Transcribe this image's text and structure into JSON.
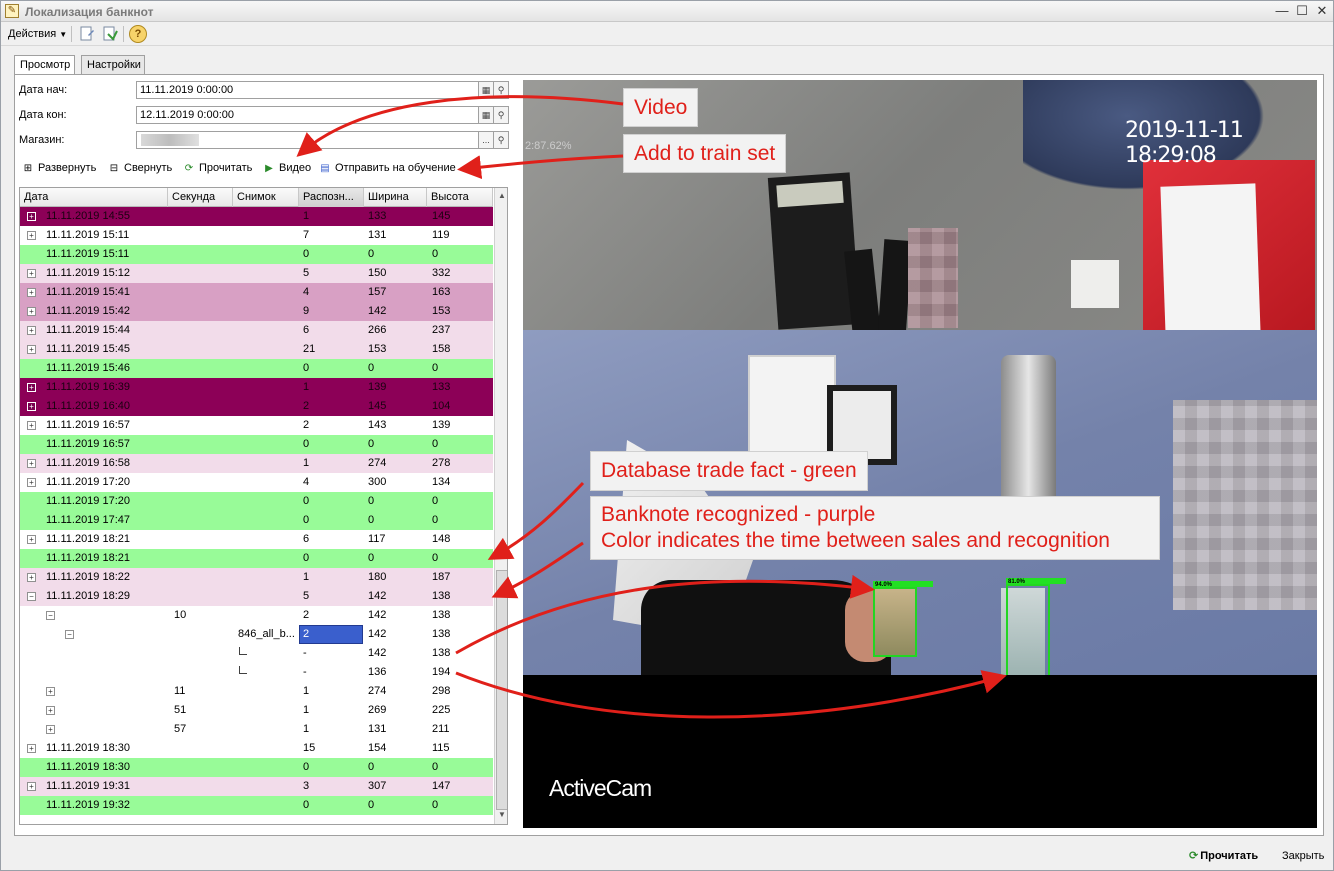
{
  "window": {
    "title": "Локализация банкнот",
    "icon": "document-edit-icon",
    "controls": [
      "minimize-icon",
      "maximize-icon",
      "close-icon"
    ]
  },
  "toolbar": {
    "actions_label": "Действия",
    "help_label": "?"
  },
  "tabs": [
    {
      "label": "Просмотр",
      "active": true
    },
    {
      "label": "Настройки",
      "active": false
    }
  ],
  "form": {
    "date_start_label": "Дата нач:",
    "date_start_value": "11.11.2019  0:00:00",
    "date_end_label": "Дата кон:",
    "date_end_value": "12.11.2019  0:00:00",
    "store_label": "Магазин:",
    "store_value": "",
    "calendar_icon": "calendar-icon",
    "search_icon": "search-icon",
    "more_label": "..."
  },
  "commands": {
    "expand": "Развернуть",
    "collapse": "Свернуть",
    "read": "Прочитать",
    "video": "Видео",
    "send_train": "Отправить на обучение"
  },
  "grid": {
    "columns": [
      "Дата",
      "Секунда",
      "Снимок",
      "Распозн...",
      "Ширина",
      "Высота"
    ],
    "colors": {
      "dark_purple": "#8c0057",
      "medium_purple": "#d8a0c4",
      "light_purple": "#f2dcea",
      "green": "#98fb98",
      "white": "#ffffff",
      "selection": "#3a5fcd"
    },
    "rows": [
      {
        "date": "11.11.2019 14:55",
        "sec": "",
        "snap": "",
        "rec": "1",
        "w": "133",
        "h": "145",
        "color": "dark",
        "level": 0,
        "expander": "+"
      },
      {
        "date": "11.11.2019 15:11",
        "sec": "",
        "snap": "",
        "rec": "7",
        "w": "131",
        "h": "119",
        "color": "white",
        "level": 0,
        "expander": "+"
      },
      {
        "date": "11.11.2019 15:11",
        "sec": "",
        "snap": "",
        "rec": "0",
        "w": "0",
        "h": "0",
        "color": "green",
        "level": 0,
        "expander": ""
      },
      {
        "date": "11.11.2019 15:12",
        "sec": "",
        "snap": "",
        "rec": "5",
        "w": "150",
        "h": "332",
        "color": "light",
        "level": 0,
        "expander": "+"
      },
      {
        "date": "11.11.2019 15:41",
        "sec": "",
        "snap": "",
        "rec": "4",
        "w": "157",
        "h": "163",
        "color": "medium",
        "level": 0,
        "expander": "+"
      },
      {
        "date": "11.11.2019 15:42",
        "sec": "",
        "snap": "",
        "rec": "9",
        "w": "142",
        "h": "153",
        "color": "medium",
        "level": 0,
        "expander": "+"
      },
      {
        "date": "11.11.2019 15:44",
        "sec": "",
        "snap": "",
        "rec": "6",
        "w": "266",
        "h": "237",
        "color": "light",
        "level": 0,
        "expander": "+"
      },
      {
        "date": "11.11.2019 15:45",
        "sec": "",
        "snap": "",
        "rec": "21",
        "w": "153",
        "h": "158",
        "color": "light",
        "level": 0,
        "expander": "+"
      },
      {
        "date": "11.11.2019 15:46",
        "sec": "",
        "snap": "",
        "rec": "0",
        "w": "0",
        "h": "0",
        "color": "green",
        "level": 0,
        "expander": ""
      },
      {
        "date": "11.11.2019 16:39",
        "sec": "",
        "snap": "",
        "rec": "1",
        "w": "139",
        "h": "133",
        "color": "dark",
        "level": 0,
        "expander": "+"
      },
      {
        "date": "11.11.2019 16:40",
        "sec": "",
        "snap": "",
        "rec": "2",
        "w": "145",
        "h": "104",
        "color": "dark",
        "level": 0,
        "expander": "+"
      },
      {
        "date": "11.11.2019 16:57",
        "sec": "",
        "snap": "",
        "rec": "2",
        "w": "143",
        "h": "139",
        "color": "white",
        "level": 0,
        "expander": "+"
      },
      {
        "date": "11.11.2019 16:57",
        "sec": "",
        "snap": "",
        "rec": "0",
        "w": "0",
        "h": "0",
        "color": "green",
        "level": 0,
        "expander": ""
      },
      {
        "date": "11.11.2019 16:58",
        "sec": "",
        "snap": "",
        "rec": "1",
        "w": "274",
        "h": "278",
        "color": "light",
        "level": 0,
        "expander": "+"
      },
      {
        "date": "11.11.2019 17:20",
        "sec": "",
        "snap": "",
        "rec": "4",
        "w": "300",
        "h": "134",
        "color": "white",
        "level": 0,
        "expander": "+"
      },
      {
        "date": "11.11.2019 17:20",
        "sec": "",
        "snap": "",
        "rec": "0",
        "w": "0",
        "h": "0",
        "color": "green",
        "level": 0,
        "expander": ""
      },
      {
        "date": "11.11.2019 17:47",
        "sec": "",
        "snap": "",
        "rec": "0",
        "w": "0",
        "h": "0",
        "color": "green",
        "level": 0,
        "expander": ""
      },
      {
        "date": "11.11.2019 18:21",
        "sec": "",
        "snap": "",
        "rec": "6",
        "w": "117",
        "h": "148",
        "color": "white",
        "level": 0,
        "expander": "+"
      },
      {
        "date": "11.11.2019 18:21",
        "sec": "",
        "snap": "",
        "rec": "0",
        "w": "0",
        "h": "0",
        "color": "green",
        "level": 0,
        "expander": ""
      },
      {
        "date": "11.11.2019 18:22",
        "sec": "",
        "snap": "",
        "rec": "1",
        "w": "180",
        "h": "187",
        "color": "light",
        "level": 0,
        "expander": "+"
      },
      {
        "date": "11.11.2019 18:29",
        "sec": "",
        "snap": "",
        "rec": "5",
        "w": "142",
        "h": "138",
        "color": "light",
        "level": 0,
        "expander": "−"
      },
      {
        "date": "",
        "sec": "10",
        "snap": "",
        "rec": "2",
        "w": "142",
        "h": "138",
        "color": "white",
        "level": 1,
        "expander": "−"
      },
      {
        "date": "",
        "sec": "",
        "snap": "846_all_b...",
        "rec": "2",
        "w": "142",
        "h": "138",
        "color": "white",
        "level": 2,
        "expander": "−",
        "selected": true
      },
      {
        "date": "",
        "sec": "",
        "snap": "",
        "rec": "-",
        "w": "142",
        "h": "138",
        "color": "white",
        "level": 3,
        "expander": ""
      },
      {
        "date": "",
        "sec": "",
        "snap": "",
        "rec": "-",
        "w": "136",
        "h": "194",
        "color": "white",
        "level": 3,
        "expander": ""
      },
      {
        "date": "",
        "sec": "11",
        "snap": "",
        "rec": "1",
        "w": "274",
        "h": "298",
        "color": "white",
        "level": 1,
        "expander": "+"
      },
      {
        "date": "",
        "sec": "51",
        "snap": "",
        "rec": "1",
        "w": "269",
        "h": "225",
        "color": "white",
        "level": 1,
        "expander": "+"
      },
      {
        "date": "",
        "sec": "57",
        "snap": "",
        "rec": "1",
        "w": "131",
        "h": "211",
        "color": "white",
        "level": 1,
        "expander": "+"
      },
      {
        "date": "11.11.2019 18:30",
        "sec": "",
        "snap": "",
        "rec": "15",
        "w": "154",
        "h": "115",
        "color": "white",
        "level": 0,
        "expander": "+"
      },
      {
        "date": "11.11.2019 18:30",
        "sec": "",
        "snap": "",
        "rec": "0",
        "w": "0",
        "h": "0",
        "color": "green",
        "level": 0,
        "expander": ""
      },
      {
        "date": "11.11.2019 19:31",
        "sec": "",
        "snap": "",
        "rec": "3",
        "w": "307",
        "h": "147",
        "color": "light",
        "level": 0,
        "expander": "+"
      },
      {
        "date": "11.11.2019 19:32",
        "sec": "",
        "snap": "",
        "rec": "0",
        "w": "0",
        "h": "0",
        "color": "green",
        "level": 0,
        "expander": ""
      }
    ]
  },
  "video": {
    "timestamp": "2019-11-11 18:29:08",
    "confidence_overlay": "2:87.62%",
    "brand": "ActiveCam",
    "box1_label": "94.0%",
    "box2_label": "81.0%"
  },
  "annotations": {
    "video": "Video",
    "train": "Add to train set",
    "green_fact": "Database trade fact - green",
    "purple_line1": "Banknote recognized - purple",
    "purple_line2": "Color indicates the time between sales and recognition",
    "arrow_color": "#e0201a"
  },
  "footer": {
    "read": "Прочитать",
    "close": "Закрыть"
  }
}
